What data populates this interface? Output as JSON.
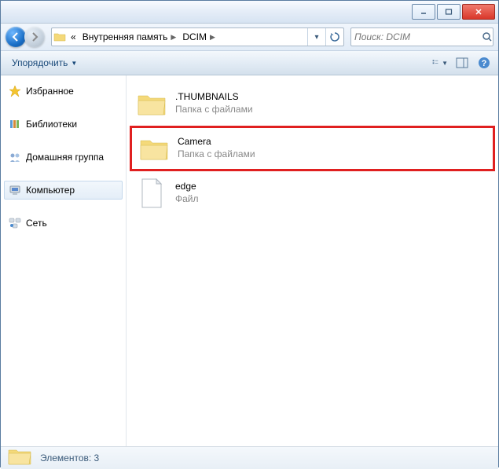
{
  "titlebar": {},
  "nav": {
    "crumb1": "Внутренняя память",
    "crumb2": "DCIM",
    "prefix": "«"
  },
  "search": {
    "placeholder": "Поиск: DCIM"
  },
  "toolbar": {
    "organize": "Упорядочить"
  },
  "sidebar": {
    "favorites": "Избранное",
    "libraries": "Библиотеки",
    "homegroup": "Домашняя группа",
    "computer": "Компьютер",
    "network": "Сеть"
  },
  "items": [
    {
      "name": ".THUMBNAILS",
      "desc": "Папка с файлами",
      "type": "folder",
      "highlight": false
    },
    {
      "name": "Camera",
      "desc": "Папка с файлами",
      "type": "folder",
      "highlight": true
    },
    {
      "name": "edge",
      "desc": "Файл",
      "type": "file",
      "highlight": false
    }
  ],
  "status": {
    "text": "Элементов: 3"
  }
}
